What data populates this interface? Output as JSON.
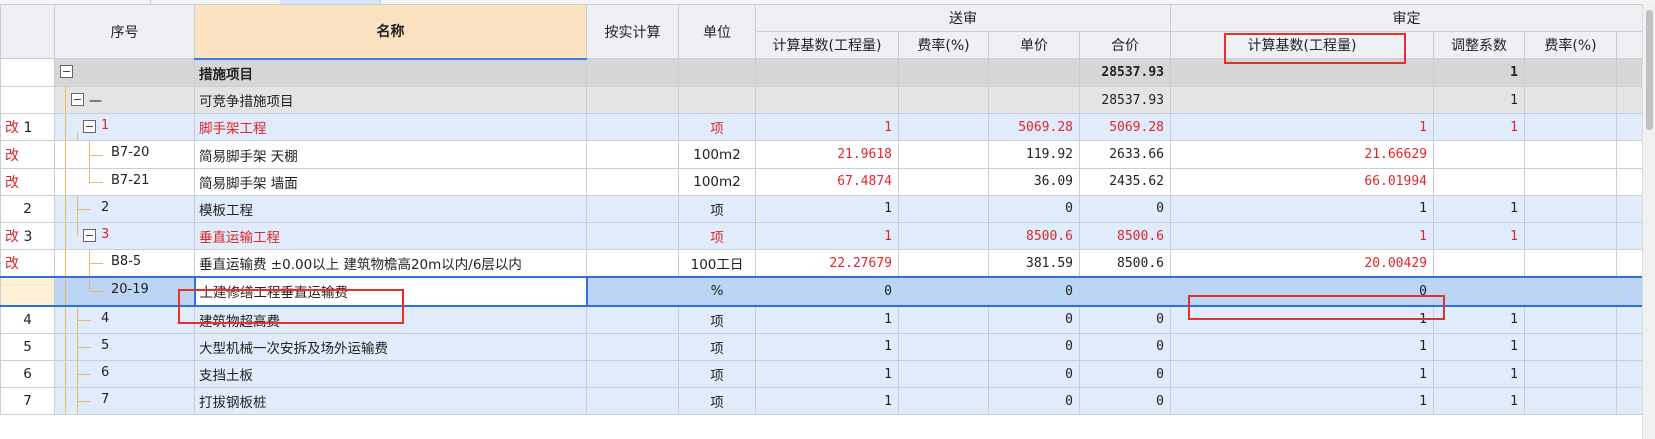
{
  "header": {
    "seq": "序号",
    "name": "名称",
    "actual_calc": "按实计算",
    "unit": "单位",
    "submit_group": "送审",
    "audit_group": "审定",
    "s_base": "计算基数(工程量)",
    "s_rate": "费率(%)",
    "s_price": "单价",
    "s_total": "合价",
    "a_base": "计算基数(工程量)",
    "a_coef": "调整系数",
    "a_rate": "费率(%)"
  },
  "rows": [
    {
      "mark": "",
      "seq": "",
      "code": "",
      "name": "措施项目",
      "unit": "",
      "s_base": "",
      "s_rate": "",
      "s_price": "",
      "s_total": "28537.93",
      "a_base": "",
      "a_coef": "1",
      "a_rate": ""
    },
    {
      "mark": "",
      "seq": "",
      "code": "一",
      "name": "可竞争措施项目",
      "unit": "",
      "s_base": "",
      "s_rate": "",
      "s_price": "",
      "s_total": "28537.93",
      "a_base": "",
      "a_coef": "1",
      "a_rate": ""
    },
    {
      "mark": "改",
      "seq": "1",
      "code": "1",
      "name": "脚手架工程",
      "unit": "项",
      "s_base": "1",
      "s_rate": "",
      "s_price": "5069.28",
      "s_total": "5069.28",
      "a_base": "1",
      "a_coef": "1",
      "a_rate": ""
    },
    {
      "mark": "改",
      "seq": "",
      "code": "B7-20",
      "name": "简易脚手架 天棚",
      "unit": "100m2",
      "s_base": "21.9618",
      "s_rate": "",
      "s_price": "119.92",
      "s_total": "2633.66",
      "a_base": "21.66629",
      "a_coef": "",
      "a_rate": ""
    },
    {
      "mark": "改",
      "seq": "",
      "code": "B7-21",
      "name": "简易脚手架 墙面",
      "unit": "100m2",
      "s_base": "67.4874",
      "s_rate": "",
      "s_price": "36.09",
      "s_total": "2435.62",
      "a_base": "66.01994",
      "a_coef": "",
      "a_rate": ""
    },
    {
      "mark": "",
      "seq": "2",
      "code": "2",
      "name": "模板工程",
      "unit": "项",
      "s_base": "1",
      "s_rate": "",
      "s_price": "0",
      "s_total": "0",
      "a_base": "1",
      "a_coef": "1",
      "a_rate": ""
    },
    {
      "mark": "改",
      "seq": "3",
      "code": "3",
      "name": "垂直运输工程",
      "unit": "项",
      "s_base": "1",
      "s_rate": "",
      "s_price": "8500.6",
      "s_total": "8500.6",
      "a_base": "1",
      "a_coef": "1",
      "a_rate": ""
    },
    {
      "mark": "改",
      "seq": "",
      "code": "B8-5",
      "name": "垂直运输费 ±0.00以上 建筑物檐高20m以内/6层以内",
      "unit": "100工日",
      "s_base": "22.27679",
      "s_rate": "",
      "s_price": "381.59",
      "s_total": "8500.6",
      "a_base": "20.00429",
      "a_coef": "",
      "a_rate": ""
    },
    {
      "mark": "",
      "seq": "",
      "code": "20-19",
      "name": "土建修缮工程垂直运输费",
      "unit": "%",
      "s_base": "0",
      "s_rate": "",
      "s_price": "0",
      "s_total": "",
      "a_base": "0",
      "a_coef": "",
      "a_rate": ""
    },
    {
      "mark": "",
      "seq": "4",
      "code": "4",
      "name": "建筑物超高费",
      "unit": "项",
      "s_base": "1",
      "s_rate": "",
      "s_price": "0",
      "s_total": "0",
      "a_base": "1",
      "a_coef": "1",
      "a_rate": ""
    },
    {
      "mark": "",
      "seq": "5",
      "code": "5",
      "name": "大型机械一次安拆及场外运输费",
      "unit": "项",
      "s_base": "1",
      "s_rate": "",
      "s_price": "0",
      "s_total": "0",
      "a_base": "1",
      "a_coef": "1",
      "a_rate": ""
    },
    {
      "mark": "",
      "seq": "6",
      "code": "6",
      "name": "支挡土板",
      "unit": "项",
      "s_base": "1",
      "s_rate": "",
      "s_price": "0",
      "s_total": "0",
      "a_base": "1",
      "a_coef": "1",
      "a_rate": ""
    },
    {
      "mark": "",
      "seq": "7",
      "code": "7",
      "name": "打拔钢板桩",
      "unit": "项",
      "s_base": "1",
      "s_rate": "",
      "s_price": "0",
      "s_total": "0",
      "a_base": "1",
      "a_coef": "1",
      "a_rate": ""
    }
  ],
  "colors": {
    "changed_text": "#e0262a",
    "highlight_box": "#e8302a",
    "selection": "#2f6fd8"
  },
  "icons": {
    "collapse": "minus-box-icon"
  },
  "glyphs": {
    "minus": "−"
  }
}
